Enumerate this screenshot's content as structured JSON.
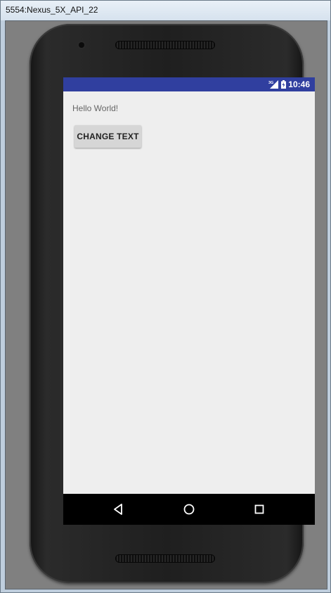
{
  "window": {
    "title": "5554:Nexus_5X_API_22"
  },
  "status_bar": {
    "network": "3G",
    "time": "10:46"
  },
  "app": {
    "text": "Hello World!",
    "button_label": "CHANGE TEXT"
  },
  "colors": {
    "status_bar": "#303f9f",
    "app_background": "#eeeeee",
    "nav_bar": "#000000"
  },
  "nav_bar": {
    "icons": [
      "back-icon",
      "home-icon",
      "recents-icon"
    ]
  }
}
